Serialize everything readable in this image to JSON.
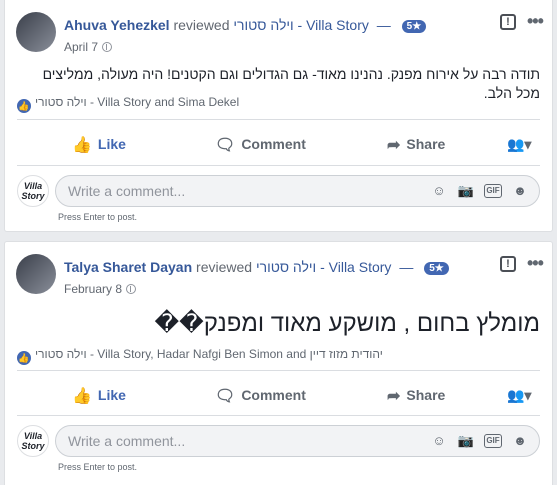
{
  "posts": [
    {
      "author": "Ahuva Yehezkel",
      "verb": "reviewed",
      "page": "וילה סטורי - Villa Story",
      "dash": "—",
      "rating": "5★",
      "date": "April 7",
      "text": "תודה רבה על אירוח מפנק. נהנינו מאוד- גם הגדולים וגם הקטנים! היה מעולה, ממליצים מכל הלב.",
      "reactions": "וילה סטורי - Villa Story and Sima Dekel",
      "actions": {
        "like": "Like",
        "comment": "Comment",
        "share": "Share"
      },
      "composer": {
        "placeholder": "Write a comment...",
        "hint": "Press Enter to post.",
        "page_avatar": "Villa Story"
      }
    },
    {
      "author": "Talya Sharet Dayan",
      "verb": "reviewed",
      "page": "וילה סטורי - Villa Story",
      "dash": "—",
      "rating": "5★",
      "date": "February 8",
      "text": "מומלץ בחום , מושקע מאוד ומפנק��",
      "reactions": "וילה סטורי - Villa Story, Hadar Nafgi Ben Simon and יהודית מזוז דיין",
      "actions": {
        "like": "Like",
        "comment": "Comment",
        "share": "Share"
      },
      "composer": {
        "placeholder": "Write a comment...",
        "hint": "Press Enter to post.",
        "page_avatar": "Villa Story"
      }
    }
  ],
  "icons": {
    "globe": "globe-icon",
    "flag": "flag-icon",
    "more": "more-icon",
    "like": "thumbs-up-icon",
    "comment": "comment-icon",
    "share": "share-icon",
    "reaction_picker": "reaction-picker-icon",
    "emoji": "emoji-icon",
    "camera": "camera-icon",
    "gif": "GIF",
    "sticker": "sticker-icon"
  },
  "colors": {
    "link": "#365899",
    "accent": "#4267b2",
    "bg": "#e9ebee"
  }
}
